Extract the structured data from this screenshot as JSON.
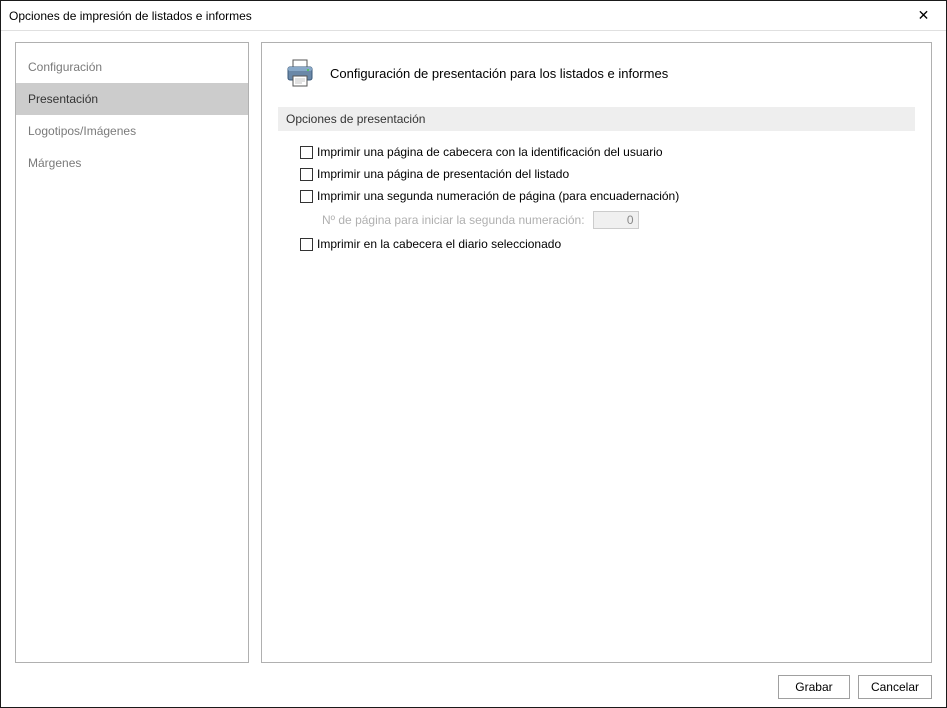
{
  "window": {
    "title": "Opciones de impresión de listados e informes"
  },
  "sidebar": {
    "items": [
      {
        "label": "Configuración",
        "selected": false
      },
      {
        "label": "Presentación",
        "selected": true
      },
      {
        "label": "Logotipos/Imágenes",
        "selected": false
      },
      {
        "label": "Márgenes",
        "selected": false
      }
    ]
  },
  "main": {
    "title": "Configuración de presentación para los listados e informes",
    "section_header": "Opciones de presentación",
    "options": {
      "opt1_label": "Imprimir una página de cabecera con la identificación del usuario",
      "opt2_label": "Imprimir una página de presentación del listado",
      "opt3_label": "Imprimir una segunda numeración de página (para encuadernación)",
      "opt3_sub_label": "Nº de página para iniciar la segunda numeración:",
      "opt3_sub_value": "0",
      "opt4_label": "Imprimir en la cabecera el diario seleccionado"
    }
  },
  "footer": {
    "save_label": "Grabar",
    "cancel_label": "Cancelar"
  }
}
